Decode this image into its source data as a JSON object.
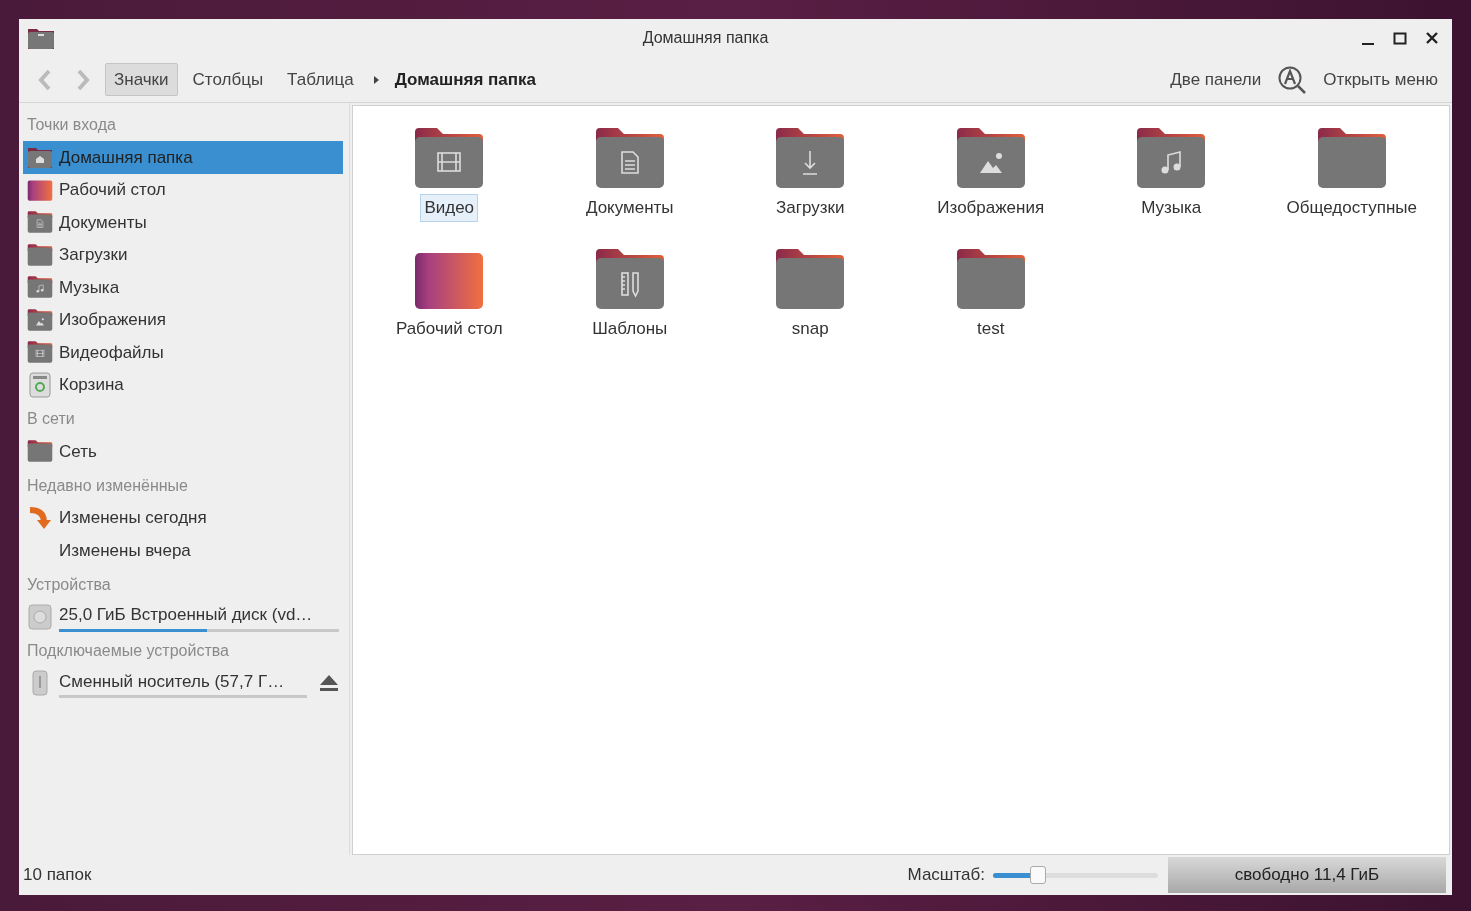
{
  "window": {
    "title": "Домашняя папка"
  },
  "toolbar": {
    "back": {
      "disabled": true
    },
    "forward": {
      "disabled": true
    },
    "views": [
      {
        "label": "Значки",
        "selected": true
      },
      {
        "label": "Столбцы",
        "selected": false
      },
      {
        "label": "Таблица",
        "selected": false
      }
    ],
    "path": [
      {
        "label": "Домашняя папка",
        "selected": true
      }
    ],
    "right": [
      {
        "label": "Две панели",
        "kind": "text"
      },
      {
        "label": "Открыть меню",
        "kind": "menu"
      }
    ]
  },
  "sidebar": [
    {
      "heading": "Точки входа",
      "items": [
        {
          "label": "Домашняя папка",
          "kind": "home",
          "selected": true
        },
        {
          "label": "Рабочий стол",
          "kind": "desktop",
          "selected": false
        },
        {
          "label": "Документы",
          "kind": "documents",
          "selected": false
        },
        {
          "label": "Загрузки",
          "kind": "folder",
          "selected": false
        },
        {
          "label": "Музыка",
          "kind": "music",
          "selected": false
        },
        {
          "label": "Изображения",
          "kind": "pictures",
          "selected": false
        },
        {
          "label": "Видеофайлы",
          "kind": "video",
          "selected": false
        },
        {
          "label": "Корзина",
          "kind": "trash",
          "selected": false
        }
      ]
    },
    {
      "heading": "В сети",
      "items": [
        {
          "label": "Сеть",
          "kind": "folder",
          "selected": false
        }
      ]
    },
    {
      "heading": "Недавно изменённые",
      "items": [
        {
          "label": "Изменены сегодня",
          "kind": "recent",
          "selected": false
        },
        {
          "label": "Изменены вчера",
          "kind": "blank",
          "selected": false
        }
      ]
    },
    {
      "heading": "Устройства",
      "items": [
        {
          "label": "25,0 ГиБ Встроенный диск (vd…",
          "kind": "disk",
          "selected": false,
          "level": 0.53
        }
      ]
    },
    {
      "heading": "Подключаемые устройства",
      "items": [
        {
          "label": "Сменный носитель (57,7 Г…",
          "kind": "usb",
          "selected": false,
          "eject": true
        }
      ]
    }
  ],
  "files": [
    {
      "name": "Видео",
      "kind": "video",
      "selected": true
    },
    {
      "name": "Документы",
      "kind": "documents",
      "selected": false
    },
    {
      "name": "Загрузки",
      "kind": "downloads",
      "selected": false
    },
    {
      "name": "Изображения",
      "kind": "pictures",
      "selected": false
    },
    {
      "name": "Музыка",
      "kind": "music",
      "selected": false
    },
    {
      "name": "Общедоступные",
      "kind": "folder",
      "selected": false
    },
    {
      "name": "Рабочий стол",
      "kind": "desktop",
      "selected": false
    },
    {
      "name": "Шаблоны",
      "kind": "templates",
      "selected": false
    },
    {
      "name": "snap",
      "kind": "folder",
      "selected": false
    },
    {
      "name": "test",
      "kind": "folder",
      "selected": false
    }
  ],
  "status_bar": {
    "count": "10 папок",
    "zoom_label": "Масштаб:",
    "zoom": {
      "level": 0.27
    },
    "free": "свободно 11,4 ГиБ"
  }
}
